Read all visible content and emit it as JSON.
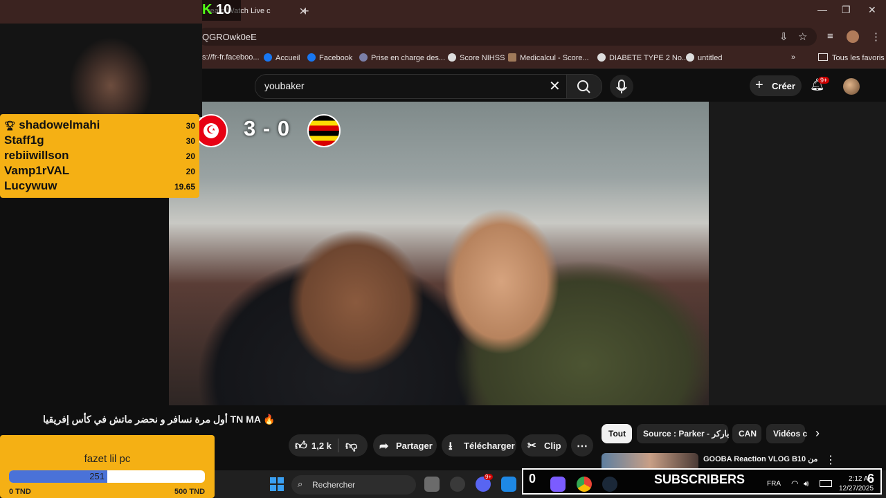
{
  "browser": {
    "tab_title": "ream Watch Live c",
    "url": "QGROwk0eE",
    "bookmarks": [
      {
        "label": "s://fr-fr.faceboo..."
      },
      {
        "label": "Accueil"
      },
      {
        "label": "Facebook"
      },
      {
        "label": "Prise en charge des..."
      },
      {
        "label": "Score NIHSS"
      },
      {
        "label": "Medicalcul - Score..."
      },
      {
        "label": "DIABETE TYPE 2 No..."
      },
      {
        "label": "untitled"
      }
    ],
    "all_bookmarks_label": "Tous les favoris",
    "colors": {
      "chrome_bg": "#3b2320"
    }
  },
  "overlay": {
    "kick_logo": "K",
    "kick_count": "10",
    "leaderboard": [
      {
        "name": "shadowelmahi",
        "score": "30"
      },
      {
        "name": "Staff1g",
        "score": "30"
      },
      {
        "name": "rebiiwillson",
        "score": "20"
      },
      {
        "name": "Vamp1rVAL",
        "score": "20"
      },
      {
        "name": "Lucywuw",
        "score": "19.65"
      }
    ],
    "goal": {
      "title": "fazet lil pc",
      "current": "251",
      "min": "0 TND",
      "max": "500 TND",
      "progress": 0.502
    },
    "subscribers": {
      "left": "0",
      "label": "SUBSCRIBERS",
      "right": "6"
    },
    "accent": "#f5b014"
  },
  "youtube": {
    "search_value": "youbaker",
    "create_label": "Créer",
    "notif_count": "9+",
    "scoreboard": {
      "home": "3",
      "sep": "-",
      "away": "0"
    },
    "video_title": "أول مرة نسافر و نحضر ماتش في كأس إفريقيا TN MA 🔥",
    "actions": {
      "likes": "1,2 k",
      "share": "Partager",
      "download": "Télécharger",
      "clip": "Clip",
      "more": "⋯"
    },
    "chips": [
      "Tout",
      "Source : Parker - باركر",
      "CAN",
      "Vidéos c"
    ],
    "related_title": "GOOBA Reaction VLOG B10 من"
  },
  "taskbar": {
    "search_label": "Rechercher",
    "badge": "9+",
    "lang": "FRA",
    "time": "2:12 A",
    "date": "12/27/2025"
  }
}
